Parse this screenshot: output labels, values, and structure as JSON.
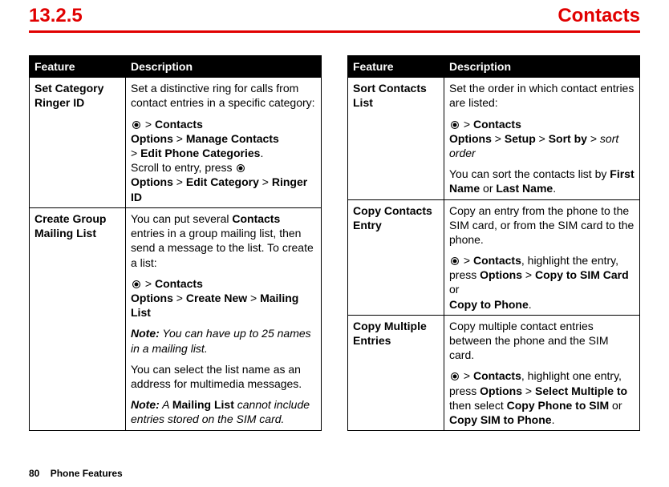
{
  "header": {
    "section": "13.2.5",
    "title": "Contacts"
  },
  "th": {
    "feature": "Feature",
    "description": "Description"
  },
  "left": {
    "r1": {
      "feature": "Set Category Ringer ID",
      "intro": "Set a distinctive ring for calls from contact entries in a specific category:",
      "nav1_pre": " > ",
      "nav1_contacts": "Contacts",
      "nav2_opts": "Options",
      "nav2_gt1": " > ",
      "nav2_mc": "Manage Contacts",
      "nav3_gt": "> ",
      "nav3_epc": "Edit Phone Categories",
      "nav3_dot": ".",
      "scroll": "Scroll to entry, press ",
      "nav4_opts": "Options",
      "nav4_gt1": " > ",
      "nav4_ec": "Edit Category",
      "nav4_gt2": " > ",
      "nav4_rid": "Ringer ID"
    },
    "r2": {
      "feature": "Create Group Mailing List",
      "intro_a": "You can put several ",
      "intro_b": "Contacts",
      "intro_c": " entries in a group mailing list, then send a message to the list. To create a list:",
      "nav1_pre": " > ",
      "nav1_contacts": "Contacts",
      "nav2_opts": "Options",
      "nav2_gt1": " > ",
      "nav2_cn": "Create New",
      "nav2_gt2": " > ",
      "nav2_ml": "Mailing List",
      "note1_label": "Note:",
      "note1_text": " You can have up to 25 names in a mailing list.",
      "para2": "You can select the list name as an address for multimedia messages.",
      "note2_label": "Note:",
      "note2_pre": " A ",
      "note2_ml": "Mailing List",
      "note2_post": " cannot include entries stored on the SIM card."
    }
  },
  "right": {
    "r1": {
      "feature": "Sort Contacts List",
      "intro": "Set the order in which contact entries are listed:",
      "nav1_pre": " > ",
      "nav1_contacts": "Contacts",
      "nav2_opts": "Options",
      "nav2_gt1": " > ",
      "nav2_setup": "Setup",
      "nav2_gt2": " > ",
      "nav2_sortby": "Sort by",
      "nav2_gt3": " > ",
      "nav2_so": "sort order",
      "para2_a": "You can sort the contacts list by ",
      "para2_fn": "First Name",
      "para2_or": " or ",
      "para2_ln": "Last Name",
      "para2_dot": "."
    },
    "r2": {
      "feature": "Copy Contacts Entry",
      "intro": "Copy an entry from the phone to the SIM card, or from the SIM card to the phone.",
      "nav_pre": " > ",
      "nav_contacts": "Contacts",
      "nav_mid": ", highlight the entry, press ",
      "nav_opts": "Options",
      "nav_gt1": " > ",
      "nav_csim": "Copy to SIM Card",
      "nav_or": " or ",
      "nav_cphone": "Copy to Phone",
      "nav_dot": "."
    },
    "r3": {
      "feature": "Copy Multiple Entries",
      "intro": "Copy multiple contact entries between the phone and the SIM card.",
      "nav_pre": " > ",
      "nav_contacts": "Contacts",
      "nav_mid": ", highlight one entry, press ",
      "nav_opts": "Options",
      "nav_gt1": " > ",
      "nav_sm": "Select Multiple to",
      "nav_then": " then select ",
      "nav_cps": "Copy Phone to SIM",
      "nav_or": " or ",
      "nav_csp": "Copy SIM to Phone",
      "nav_dot": "."
    }
  },
  "footer": {
    "page": "80",
    "label": "Phone Features"
  }
}
